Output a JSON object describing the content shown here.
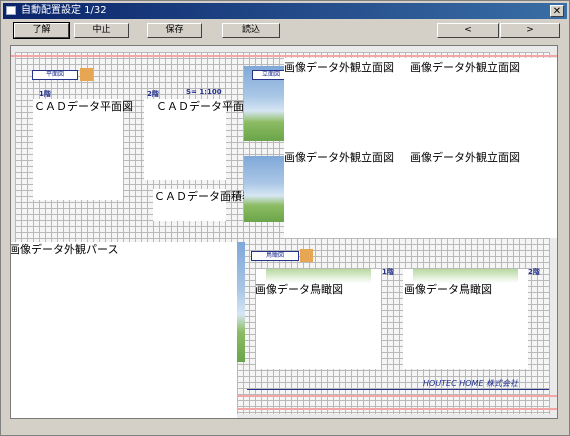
{
  "window": {
    "title": "自動配置設定 1/32",
    "close_label": "✕"
  },
  "toolbar": {
    "ok_label": "了解",
    "cancel_label": "中止",
    "save_label": "保存",
    "load_label": "読込",
    "prev_label": "<",
    "next_label": ">"
  },
  "sheet": {
    "plan_tag": "平面図",
    "elevation_tag": "立面図",
    "bird_tag": "鳥瞰図",
    "floor1": "1階",
    "floor2": "2階",
    "scale": "S= 1:100",
    "cad_plan_1": "ＣＡＤデータ平面図",
    "cad_plan_2": "ＣＡＤデータ平面図",
    "cad_area_table": "ＣＡＤデータ面積表",
    "elev_1": "画像データ外観立面図",
    "elev_2": "画像データ外観立面図",
    "elev_3": "画像データ外観立面図",
    "elev_4": "画像データ外観立面図",
    "perspective": "画像データ外観パース",
    "bird_1": "画像データ鳥瞰図",
    "bird_2": "画像データ鳥瞰図",
    "bird_floor1": "1階",
    "bird_floor2": "2階",
    "company": "HOUTEC HOME  株式会社"
  }
}
